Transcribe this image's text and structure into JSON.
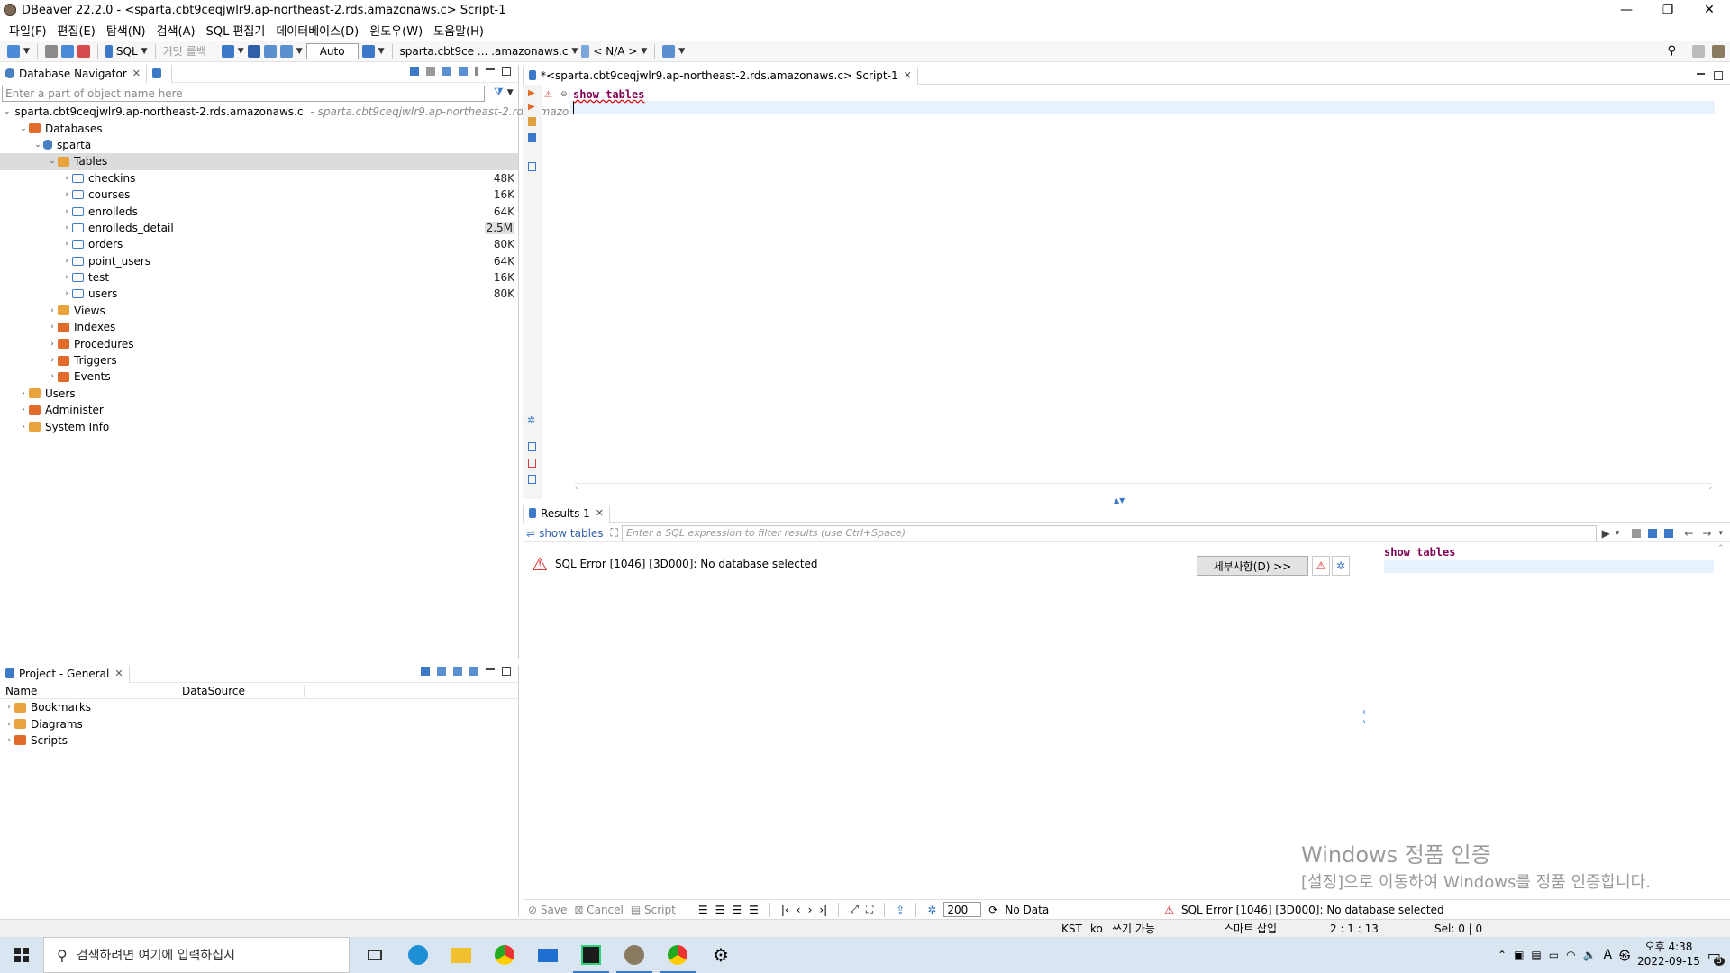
{
  "window": {
    "title": "DBeaver 22.2.0 - <sparta.cbt9ceqjwlr9.ap-northeast-2.rds.amazonaws.c> Script-1"
  },
  "menu": [
    "파일(F)",
    "편집(E)",
    "탐색(N)",
    "검색(A)",
    "SQL 편집기",
    "데이터베이스(D)",
    "윈도우(W)",
    "도움말(H)"
  ],
  "toolbar": {
    "sql": "SQL",
    "commit": "커밋",
    "rollback": "롤백",
    "auto": "Auto",
    "datasource": "sparta.cbt9ce ... .amazonaws.c",
    "schema": "< N/A >"
  },
  "navigator": {
    "tab": "Database Navigator",
    "filter_placeholder": "Enter a part of object name here",
    "connection": "sparta.cbt9ceqjwlr9.ap-northeast-2.rds.amazonaws.c",
    "connection_hint": "- sparta.cbt9ceqjwlr9.ap-northeast-2.rds.amazo",
    "databases": "Databases",
    "schema": "sparta",
    "tables_label": "Tables",
    "tables": [
      {
        "name": "checkins",
        "size": "48K"
      },
      {
        "name": "courses",
        "size": "16K"
      },
      {
        "name": "enrolleds",
        "size": "64K"
      },
      {
        "name": "enrolleds_detail",
        "size": "2.5M"
      },
      {
        "name": "orders",
        "size": "80K"
      },
      {
        "name": "point_users",
        "size": "64K"
      },
      {
        "name": "test",
        "size": "16K"
      },
      {
        "name": "users",
        "size": "80K"
      }
    ],
    "schema_folders": [
      "Views",
      "Indexes",
      "Procedures",
      "Triggers",
      "Events"
    ],
    "conn_folders": [
      "Users",
      "Administer",
      "System Info"
    ]
  },
  "project": {
    "tab": "Project - General",
    "col_name": "Name",
    "col_datasource": "DataSource",
    "items": [
      "Bookmarks",
      "Diagrams",
      "Scripts"
    ]
  },
  "editor": {
    "tab": "*<sparta.cbt9ceqjwlr9.ap-northeast-2.rds.amazonaws.c> Script-1",
    "code": "show tables"
  },
  "results": {
    "tab": "Results 1",
    "query_label": "show tables",
    "filter_placeholder": "Enter a SQL expression to filter results (use Ctrl+Space)",
    "error": "SQL Error [1046] [3D000]: No database selected",
    "detail_button": "세부사항(D) >>",
    "side_code": "show tables",
    "bottom": {
      "save": "Save",
      "cancel": "Cancel",
      "script": "Script",
      "rows": "200",
      "nodata": "No Data",
      "error": "SQL Error [1046] [3D000]: No database selected"
    }
  },
  "status": {
    "tz": "KST",
    "lang": "ko",
    "mode": "쓰기 가능",
    "insert": "스마트 삽입",
    "pos": "2 : 1 : 13",
    "sel": "Sel: 0 | 0"
  },
  "watermark": {
    "line1": "Windows 정품 인증",
    "line2": "[설정]으로 이동하여 Windows를 정품 인증합니다."
  },
  "taskbar": {
    "search_placeholder": "검색하려면 여기에 입력하십시",
    "time": "오후 4:38",
    "date": "2022-09-15",
    "ime": "A",
    "ime2": "㉿",
    "notif_count": "5"
  },
  "colors": {
    "accent": "#3c7ac9",
    "keyword": "#7f0055",
    "error": "#d42020"
  }
}
